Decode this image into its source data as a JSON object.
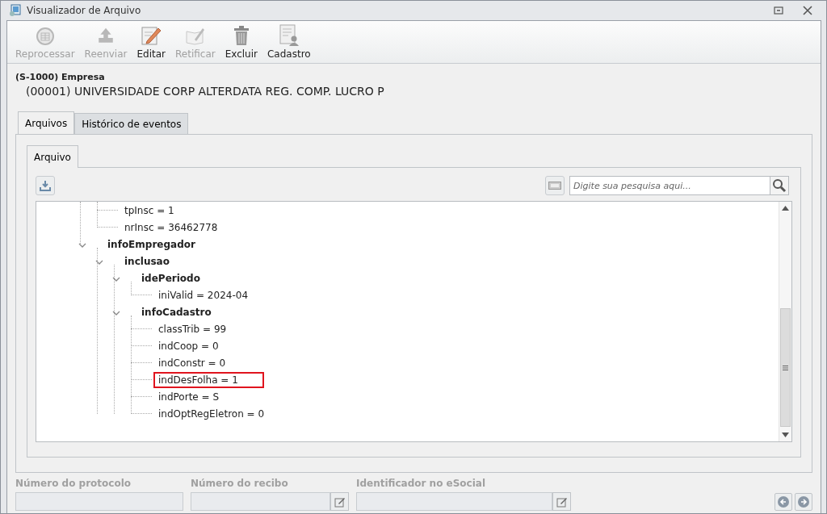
{
  "window": {
    "title": "Visualizador de Arquivo"
  },
  "toolbar": [
    {
      "label": "Reprocessar",
      "kind": "reprocess",
      "disabled": true
    },
    {
      "label": "Reenviar",
      "kind": "upload",
      "disabled": true
    },
    {
      "label": "Editar",
      "kind": "edit",
      "disabled": false
    },
    {
      "label": "Retificar",
      "kind": "rectify",
      "disabled": true
    },
    {
      "label": "Excluir",
      "kind": "trash",
      "disabled": false
    },
    {
      "label": "Cadastro",
      "kind": "register",
      "disabled": false
    }
  ],
  "header": {
    "event": "(S-1000) Empresa",
    "company": "(00001) UNIVERSIDADE CORP ALTERDATA REG. COMP. LUCRO P"
  },
  "tabs": [
    {
      "label": "Arquivos",
      "selected": true
    },
    {
      "label": "Histórico de eventos",
      "selected": false
    }
  ],
  "inner_tabs": [
    {
      "label": "Arquivo",
      "selected": true
    }
  ],
  "search": {
    "placeholder": "Digite sua pesquisa aqui..."
  },
  "tree": {
    "continued": [
      {
        "label": "tpInsc = 1",
        "highlighted": false
      },
      {
        "label": "nrInsc = 36462778",
        "highlighted": false
      }
    ],
    "nodes": [
      {
        "label": "infoEmpregador",
        "expanded": true,
        "children": [
          {
            "label": "inclusao",
            "expanded": true,
            "children": [
              {
                "label": "idePeriodo",
                "expanded": true,
                "children": [
                  {
                    "label": "iniValid = 2024-04",
                    "highlighted": false
                  }
                ]
              },
              {
                "label": "infoCadastro",
                "expanded": true,
                "children": [
                  {
                    "label": "classTrib = 99",
                    "highlighted": false
                  },
                  {
                    "label": "indCoop = 0",
                    "highlighted": false
                  },
                  {
                    "label": "indConstr = 0",
                    "highlighted": false
                  },
                  {
                    "label": "indDesFolha = 1",
                    "highlighted": true
                  },
                  {
                    "label": "indPorte = S",
                    "highlighted": false
                  },
                  {
                    "label": "indOptRegEletron = 0",
                    "highlighted": false
                  }
                ]
              }
            ]
          }
        ]
      }
    ]
  },
  "fields": [
    {
      "label": "Número do protocolo",
      "editable": false
    },
    {
      "label": "Número do recibo",
      "editable": true
    },
    {
      "label": "Identificador no eSocial",
      "editable": true
    }
  ]
}
